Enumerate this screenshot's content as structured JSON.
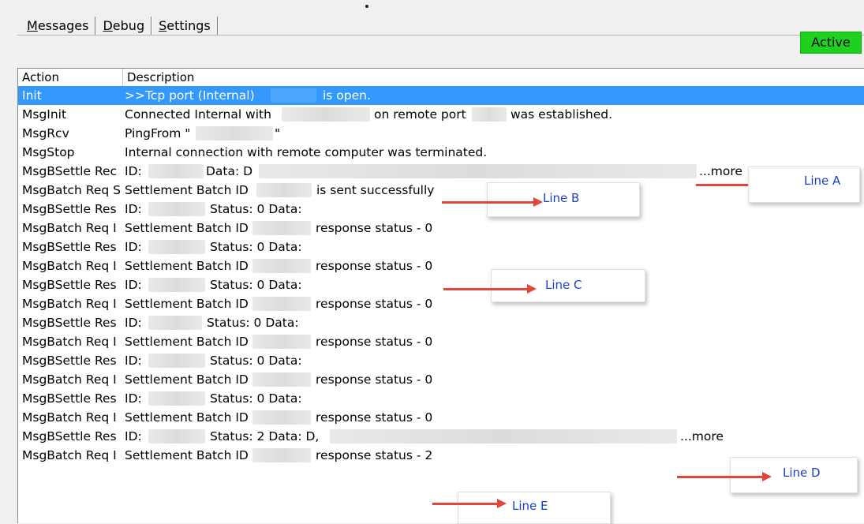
{
  "tabs": [
    {
      "accel": "M",
      "rest": "essages"
    },
    {
      "accel": "D",
      "rest": "ebug"
    },
    {
      "accel": "S",
      "rest": "ettings"
    }
  ],
  "status_badge": "Active",
  "colors": {
    "selected_row": "#3399ff",
    "active_badge": "#1ed11e",
    "annotation_arrow": "#e2453b",
    "annotation_text": "#1a3fcf"
  },
  "columns": {
    "action": "Action",
    "description": "Description"
  },
  "rows": [
    {
      "action": "Init",
      "a": ">>Tcp port (Internal)",
      "b": "is open."
    },
    {
      "action": "MsgInit",
      "a": "Connected Internal with",
      "b": "on remote port",
      "c": "was established."
    },
    {
      "action": "MsgRcv",
      "a": "PingFrom \"",
      "b": "\""
    },
    {
      "action": "MsgStop",
      "a": "Internal connection with remote computer was terminated."
    },
    {
      "action": "MsgBSettle Rec",
      "a": "ID:",
      "b": "Data: D",
      "c": "...more"
    },
    {
      "action": "MsgBatch Req S",
      "a": "Settlement Batch ID",
      "b": "is sent successfully"
    },
    {
      "action": "MsgBSettle Res",
      "a": "ID:",
      "b": "Status: 0 Data:"
    },
    {
      "action": "MsgBatch Req I",
      "a": "Settlement Batch ID",
      "b": "response status - 0"
    },
    {
      "action": "MsgBSettle Res",
      "a": "ID:",
      "b": "Status: 0 Data:"
    },
    {
      "action": "MsgBatch Req I",
      "a": "Settlement Batch ID",
      "b": "response status - 0"
    },
    {
      "action": "MsgBSettle Res",
      "a": "ID:",
      "b": "Status: 0 Data:"
    },
    {
      "action": "MsgBatch Req I",
      "a": "Settlement Batch ID",
      "b": "response status - 0"
    },
    {
      "action": "MsgBSettle Res",
      "a": "ID:",
      "b": "Status: 0 Data:"
    },
    {
      "action": "MsgBatch Req I",
      "a": "Settlement Batch ID",
      "b": "response status - 0"
    },
    {
      "action": "MsgBSettle Res",
      "a": "ID:",
      "b": "Status: 0 Data:"
    },
    {
      "action": "MsgBatch Req I",
      "a": "Settlement Batch ID",
      "b": "response status - 0"
    },
    {
      "action": "MsgBSettle Res",
      "a": "ID:",
      "b": "Status: 0 Data:"
    },
    {
      "action": "MsgBatch Req I",
      "a": "Settlement Batch ID",
      "b": "response status - 0"
    },
    {
      "action": "MsgBSettle Res",
      "a": "ID:",
      "b": "Status: 2 Data: D,",
      "c": "...more"
    },
    {
      "action": "MsgBatch Req I",
      "a": "Settlement Batch ID",
      "b": "response status - 2"
    }
  ],
  "annotations": {
    "a": "Line A",
    "b": "Line B",
    "c": "Line C",
    "d": "Line D",
    "e": "Line E"
  }
}
